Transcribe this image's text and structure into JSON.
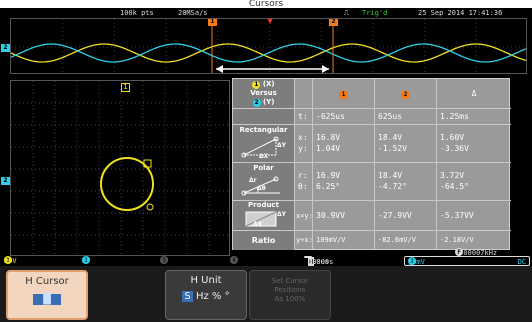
{
  "caption": "Cursors",
  "top_bar": {
    "points": "100k pts",
    "sample_rate": "20MSa/s",
    "trigger_status": "Trig'd",
    "date_time": "25 Sep 2014 17:41:36"
  },
  "waveform": {
    "ch1_color": "#f0e020",
    "ch2_color": "#2ad0e8",
    "cursor1_marker": "1",
    "cursor2_marker": "2",
    "ch2_level_marker": "2",
    "trigger_marker": "▼"
  },
  "xy": {
    "ch1_marker": "1",
    "ch2_marker": "2"
  },
  "cursor_table": {
    "header": {
      "xy_line1_badge": "1",
      "xy_line1_text": "(X)",
      "xy_versus": "Versus",
      "xy_line3_badge": "2",
      "xy_line3_text": "(Y)",
      "cursor1": "1",
      "cursor2": "2",
      "delta": "Δ"
    },
    "time": {
      "label": "t:",
      "c1": "-625us",
      "c2": "625us",
      "delta": "1.25ms"
    },
    "rectangular": {
      "title": "Rectangular",
      "x_label": "x:",
      "y_label": "y:",
      "x_c1": "16.8V",
      "x_c2": "18.4V",
      "x_delta": "1.60V",
      "y_c1": "1.04V",
      "y_c2": "-1.52V",
      "y_delta": "-3.36V",
      "icon_dx": "ΔX",
      "icon_dy": "ΔY"
    },
    "polar": {
      "title": "Polar",
      "r_label": "r:",
      "theta_label": "θ:",
      "r_c1": "16.9V",
      "r_c2": "18.4V",
      "r_delta": "3.72V",
      "theta_c1": "6.25°",
      "theta_c2": "-4.72°",
      "theta_delta": "-64.5°",
      "icon_dr": "Δr",
      "icon_dtheta": "Δθ"
    },
    "product": {
      "title": "Product",
      "label": "x×y:",
      "c1": "30.9VV",
      "c2": "-27.9VV",
      "delta": "-5.37VV",
      "icon_dx": "ΔX",
      "icon_dy": "ΔY"
    },
    "ratio": {
      "title": "Ratio",
      "label": "y÷x:",
      "c1": "109mV/V",
      "c2": "-82.6mV/V",
      "delta": "-2.18V/V"
    }
  },
  "channel_bar": {
    "ch1_num": "1",
    "ch1_coupling": "═",
    "ch1_scale": "20V",
    "ch2_num": "2",
    "ch2_coupling": "═",
    "ch2_scale": "2V",
    "ch3_num": "3",
    "ch3_coupling": "═",
    "ch3_scale": "1V",
    "ch4_num": "4",
    "ch4_coupling": "═",
    "ch4_scale": "1V",
    "timebase": "500us",
    "h_icon": "H",
    "h_position": "0.000s",
    "frequency_icon": "F",
    "frequency": "1.00007kHz",
    "trig_ch": "2",
    "trig_slope": "⨍",
    "trig_level": "80mV",
    "trig_coupling": "DC"
  },
  "softkeys": {
    "h_cursor": "H Cursor",
    "h_cursor_icon": "▐▌",
    "h_unit": "H Unit",
    "h_unit_selected": "S",
    "h_unit_options": "Hz % °",
    "set_cursor_line1": "Set Cursor",
    "set_cursor_line2": "Positions",
    "set_cursor_line3": "As 100%"
  }
}
